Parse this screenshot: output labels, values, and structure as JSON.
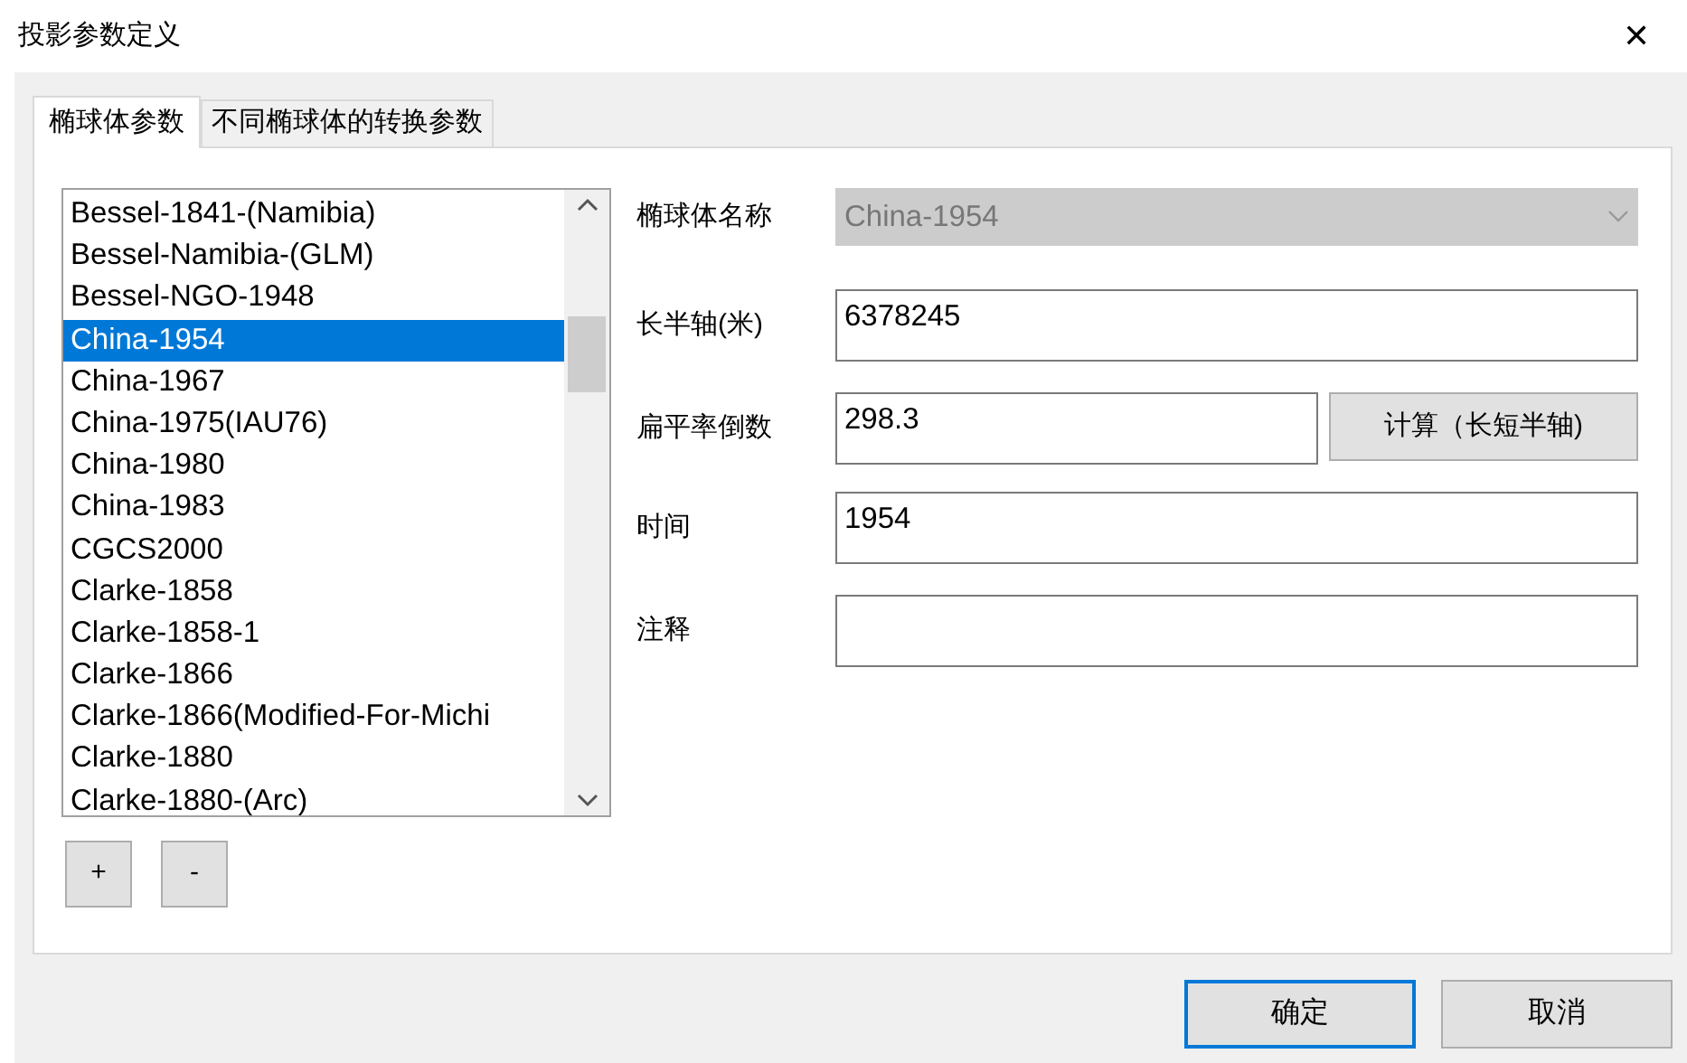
{
  "window": {
    "title": "投影参数定义",
    "close": "✕"
  },
  "tabs": [
    {
      "label": "椭球体参数",
      "selected": true
    },
    {
      "label": "不同椭球体的转换参数",
      "selected": false
    }
  ],
  "ellipsoid_list": {
    "items": [
      {
        "label": "Bessel-1841-(Namibia)",
        "selected": false
      },
      {
        "label": "Bessel-Namibia-(GLM)",
        "selected": false
      },
      {
        "label": "Bessel-NGO-1948",
        "selected": false
      },
      {
        "label": "China-1954",
        "selected": true
      },
      {
        "label": "China-1967",
        "selected": false
      },
      {
        "label": "China-1975(IAU76)",
        "selected": false
      },
      {
        "label": "China-1980",
        "selected": false
      },
      {
        "label": "China-1983",
        "selected": false
      },
      {
        "label": "CGCS2000",
        "selected": false
      },
      {
        "label": "Clarke-1858",
        "selected": false
      },
      {
        "label": "Clarke-1858-1",
        "selected": false
      },
      {
        "label": "Clarke-1866",
        "selected": false
      },
      {
        "label": "Clarke-1866(Modified-For-Michi",
        "selected": false
      },
      {
        "label": "Clarke-1880",
        "selected": false
      },
      {
        "label": "Clarke-1880-(Arc)",
        "selected": false
      }
    ],
    "buttons": [
      "+",
      "-"
    ]
  },
  "form": [
    {
      "kind": "select",
      "label": "椭球体名称",
      "value": "China-1954",
      "disabled": true
    },
    {
      "kind": "text",
      "label": "长半轴(米)",
      "value": "6378245"
    },
    {
      "kind": "text_button",
      "label": "扁平率倒数",
      "value": "298.3",
      "button": "计算（长短半轴)"
    },
    {
      "kind": "text",
      "label": "时间",
      "value": "1954"
    },
    {
      "kind": "text",
      "label": "注释"
    }
  ],
  "buttons": [
    {
      "label": "确定",
      "default": true
    },
    {
      "label": "取消",
      "default": false
    }
  ]
}
